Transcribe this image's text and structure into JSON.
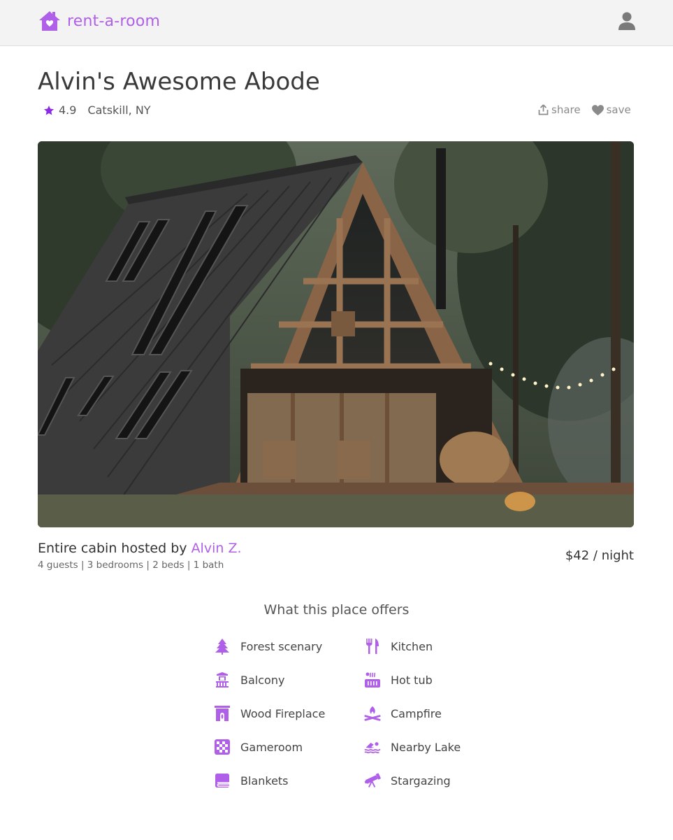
{
  "header": {
    "brand": "rent-a-room",
    "brand_color": "#b060e8"
  },
  "listing": {
    "title": "Alvin's Awesome Abode",
    "rating": "4.9",
    "location": "Catskill, NY",
    "share_label": "share",
    "save_label": "save",
    "hosted_prefix": "Entire cabin hosted by ",
    "host_name": "Alvin Z.",
    "details": "4 guests | 3 bedrooms | 2 beds | 1 bath",
    "price": "$42 / night"
  },
  "offers": {
    "title": "What this place offers",
    "items": [
      {
        "label": "Forest scenary",
        "icon": "tree-icon"
      },
      {
        "label": "Kitchen",
        "icon": "utensils-icon"
      },
      {
        "label": "Balcony",
        "icon": "balcony-icon"
      },
      {
        "label": "Hot tub",
        "icon": "hot-tub-icon"
      },
      {
        "label": "Wood Fireplace",
        "icon": "fireplace-icon"
      },
      {
        "label": "Campfire",
        "icon": "campfire-icon"
      },
      {
        "label": "Gameroom",
        "icon": "checkerboard-icon"
      },
      {
        "label": "Nearby Lake",
        "icon": "swimmer-icon"
      },
      {
        "label": "Blankets",
        "icon": "blanket-icon"
      },
      {
        "label": "Stargazing",
        "icon": "telescope-icon"
      }
    ]
  }
}
